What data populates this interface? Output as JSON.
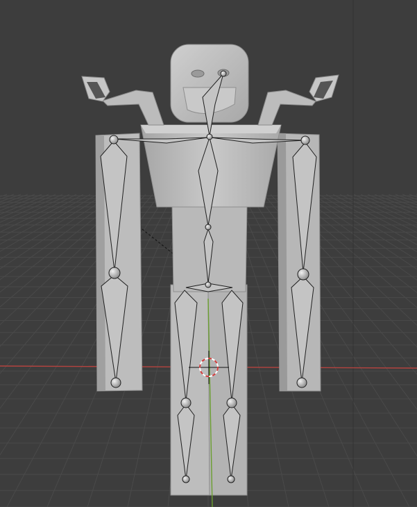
{
  "viewport": {
    "background": "#3d3d3d",
    "grid_color": "#4a4a4a",
    "x_axis_color": "#b5433f",
    "y_axis_color": "#6a9e2f",
    "mesh_color": "#b9b9b9",
    "mesh_shade": "#9d9d9d",
    "bone_color": "#c4c4c4",
    "bone_outline": "#1f1f1f",
    "cursor_color": "#d23b3b"
  },
  "scene": {
    "mesh": "humanoid-mesh",
    "armature": "armature",
    "bones": [
      "spine",
      "spine-upper",
      "neck-head",
      "shoulder-left",
      "shoulder-right",
      "upper-arm-left",
      "forearm-left",
      "upper-arm-right",
      "forearm-right",
      "pelvis",
      "thigh-left",
      "shin-left",
      "thigh-right",
      "shin-right"
    ]
  }
}
